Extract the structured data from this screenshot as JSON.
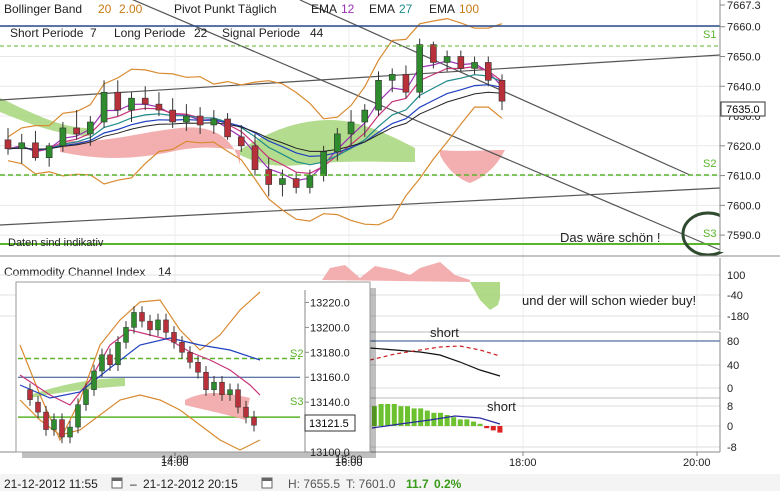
{
  "indicators": {
    "bollinger": {
      "label": "Bollinger Band",
      "p1": "20",
      "p2": "2.00"
    },
    "pivot": "Pivot Punkt Täglich",
    "emas": [
      {
        "label": "EMA",
        "value": "12",
        "color": "#9b2fb5"
      },
      {
        "label": "EMA",
        "value": "27",
        "color": "#1f8a8a"
      },
      {
        "label": "EMA",
        "value": "100",
        "color": "#c87a14"
      }
    ],
    "short_periode": {
      "label": "Short Periode",
      "value": "7"
    },
    "long_periode": {
      "label": "Long Periode",
      "value": "22"
    },
    "signal_periode": {
      "label": "Signal Periode",
      "value": "44"
    },
    "disclaimer": "Daten sind indikativ"
  },
  "annotations": {
    "wish": "Das wäre schön !",
    "buy": "und der will schon wieder buy!",
    "short1": "short",
    "short2": "short"
  },
  "main_panel": {
    "axis_ticks": [
      "7667.3",
      "7660.0",
      "7650.0",
      "7640.0",
      "7630.0",
      "7620.0",
      "7610.0",
      "7600.0",
      "7590.0"
    ],
    "current_price": "7635.0",
    "pivot_labels": [
      "S1",
      "S2",
      "S3"
    ]
  },
  "cci_panel": {
    "title": "Commodity Channel Index",
    "period": "14",
    "axis_ticks": [
      "100",
      "-40",
      "-180"
    ]
  },
  "lower_panels": {
    "panel2_ticks": [
      "80",
      "40",
      "0"
    ],
    "panel3_ticks": [
      "8",
      "0",
      "-8"
    ]
  },
  "inset": {
    "axis_ticks": [
      "13220.0",
      "13200.0",
      "13180.0",
      "13160.0",
      "13140.0",
      "13121.5",
      "13100.0"
    ],
    "current_price": "13121.5",
    "labels": [
      "S2",
      "S3"
    ],
    "time_ticks": [
      "14:00",
      "16:00"
    ]
  },
  "time_axis": [
    "14:00",
    "16:00",
    "18:00",
    "20:00"
  ],
  "status_bar": {
    "from": "21-12-2012 11:55",
    "to": "21-12-2012 20:15",
    "high": "H: 7655.5",
    "low": "T: 7601.0",
    "change": "11.7",
    "change_pct": "0.2%"
  },
  "colors": {
    "bull_candle": "#2e8b2e",
    "bear_candle": "#b8303a",
    "cloud_green": "#a7d67a",
    "cloud_red": "#f2a6a6",
    "pivot_green": "#5ab52a",
    "bollinger": "#d98a30",
    "ema_fast": "#c8347a",
    "ema_slow": "#2040c0",
    "change_positive": "#3a9a1a"
  },
  "chart_data": {
    "type": "candlestick",
    "title": "",
    "ylim": [
      7585,
      7667.3
    ],
    "candles": [
      {
        "t": "11:55",
        "o": 7622,
        "h": 7626,
        "l": 7617,
        "c": 7619
      },
      {
        "t": "12:05",
        "o": 7619,
        "h": 7624,
        "l": 7614,
        "c": 7621
      },
      {
        "t": "12:15",
        "o": 7621,
        "h": 7625,
        "l": 7615,
        "c": 7616
      },
      {
        "t": "12:25",
        "o": 7616,
        "h": 7621,
        "l": 7613,
        "c": 7620
      },
      {
        "t": "12:35",
        "o": 7620,
        "h": 7628,
        "l": 7618,
        "c": 7626
      },
      {
        "t": "12:45",
        "o": 7626,
        "h": 7632,
        "l": 7622,
        "c": 7624
      },
      {
        "t": "12:55",
        "o": 7624,
        "h": 7630,
        "l": 7620,
        "c": 7628
      },
      {
        "t": "13:05",
        "o": 7628,
        "h": 7642,
        "l": 7626,
        "c": 7638
      },
      {
        "t": "13:15",
        "o": 7638,
        "h": 7642,
        "l": 7630,
        "c": 7632
      },
      {
        "t": "13:25",
        "o": 7632,
        "h": 7638,
        "l": 7628,
        "c": 7636
      },
      {
        "t": "13:35",
        "o": 7636,
        "h": 7640,
        "l": 7632,
        "c": 7634
      },
      {
        "t": "13:45",
        "o": 7634,
        "h": 7638,
        "l": 7630,
        "c": 7632
      },
      {
        "t": "13:55",
        "o": 7632,
        "h": 7636,
        "l": 7626,
        "c": 7628
      },
      {
        "t": "14:05",
        "o": 7628,
        "h": 7634,
        "l": 7625,
        "c": 7630
      },
      {
        "t": "14:15",
        "o": 7630,
        "h": 7633,
        "l": 7624,
        "c": 7627
      },
      {
        "t": "14:25",
        "o": 7627,
        "h": 7632,
        "l": 7624,
        "c": 7629
      },
      {
        "t": "14:35",
        "o": 7629,
        "h": 7631,
        "l": 7622,
        "c": 7623
      },
      {
        "t": "14:45",
        "o": 7623,
        "h": 7627,
        "l": 7618,
        "c": 7620
      },
      {
        "t": "14:55",
        "o": 7620,
        "h": 7624,
        "l": 7610,
        "c": 7612
      },
      {
        "t": "15:05",
        "o": 7612,
        "h": 7616,
        "l": 7603,
        "c": 7607
      },
      {
        "t": "15:15",
        "o": 7607,
        "h": 7612,
        "l": 7603,
        "c": 7609
      },
      {
        "t": "15:25",
        "o": 7609,
        "h": 7611,
        "l": 7604,
        "c": 7606
      },
      {
        "t": "15:35",
        "o": 7606,
        "h": 7612,
        "l": 7604,
        "c": 7610
      },
      {
        "t": "15:45",
        "o": 7610,
        "h": 7620,
        "l": 7608,
        "c": 7618
      },
      {
        "t": "15:55",
        "o": 7618,
        "h": 7626,
        "l": 7615,
        "c": 7624
      },
      {
        "t": "16:05",
        "o": 7624,
        "h": 7632,
        "l": 7620,
        "c": 7628
      },
      {
        "t": "16:15",
        "o": 7628,
        "h": 7634,
        "l": 7623,
        "c": 7632
      },
      {
        "t": "16:25",
        "o": 7632,
        "h": 7645,
        "l": 7630,
        "c": 7642
      },
      {
        "t": "16:35",
        "o": 7642,
        "h": 7646,
        "l": 7638,
        "c": 7644
      },
      {
        "t": "16:45",
        "o": 7644,
        "h": 7647,
        "l": 7636,
        "c": 7638
      },
      {
        "t": "16:55",
        "o": 7638,
        "h": 7656,
        "l": 7636,
        "c": 7654
      },
      {
        "t": "17:05",
        "o": 7654,
        "h": 7655,
        "l": 7646,
        "c": 7648
      },
      {
        "t": "17:15",
        "o": 7648,
        "h": 7652,
        "l": 7645,
        "c": 7650
      },
      {
        "t": "17:25",
        "o": 7650,
        "h": 7652,
        "l": 7645,
        "c": 7646
      },
      {
        "t": "17:35",
        "o": 7646,
        "h": 7650,
        "l": 7644,
        "c": 7648
      },
      {
        "t": "17:45",
        "o": 7648,
        "h": 7650,
        "l": 7640,
        "c": 7642
      },
      {
        "t": "17:55",
        "o": 7642,
        "h": 7644,
        "l": 7632,
        "c": 7635
      }
    ]
  }
}
